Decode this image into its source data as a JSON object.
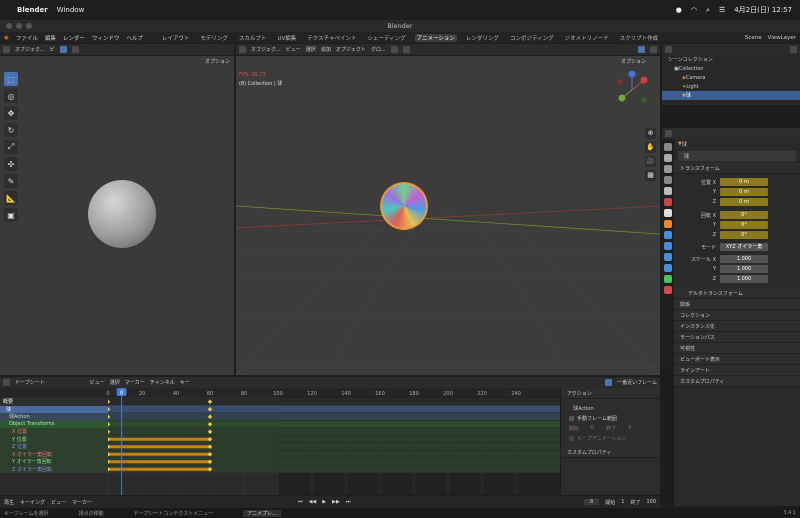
{
  "mac": {
    "app_name": "Blender",
    "menu_window": "Window",
    "datetime": "4月2日(日) 12:57"
  },
  "window": {
    "title": "Blender",
    "version": "3.4.1"
  },
  "topmenu": {
    "items": [
      "ファイル",
      "編集",
      "レンダー",
      "ウィンドウ",
      "ヘルプ"
    ],
    "tabs": [
      "レイアウト",
      "モデリング",
      "スカルプト",
      "UV編集",
      "テクスチャペイント",
      "シェーディング",
      "アニメーション",
      "レンダリング",
      "コンポジティング",
      "ジオメトリノード",
      "スクリプト作成"
    ],
    "active_tab": "アニメーション",
    "scene": "Scene",
    "view_layer": "ViewLayer"
  },
  "left_vp": {
    "mode": "オブジェク...",
    "view_label": "ビ",
    "options": "オプション"
  },
  "main_vp": {
    "mode": "オブジェク...",
    "menus": [
      "ビュー",
      "選択",
      "追加",
      "オブジェクト"
    ],
    "transform": "グロ...",
    "options": "オプション",
    "fps": "FPS: 29.73",
    "collection_label": "(8) Collection | 球"
  },
  "outliner": {
    "root": "シーンコレクション",
    "collection": "Collection",
    "items": [
      "Camera",
      "Light",
      "球"
    ]
  },
  "properties": {
    "object_name": "球",
    "mesh_name": "球",
    "transform_title": "トランスフォーム",
    "location": {
      "label": "位置 X",
      "y": "Y",
      "z": "Z",
      "x_val": "0 m",
      "y_val": "0 m",
      "z_val": "0 m"
    },
    "rotation": {
      "label": "回転 X",
      "y": "Y",
      "z": "Z",
      "x_val": "0°",
      "y_val": "0°",
      "z_val": "0°"
    },
    "mode_label": "モード",
    "mode_val": "XYZ オイラー角",
    "scale": {
      "label": "スケール X",
      "y": "Y",
      "z": "Z",
      "x_val": "1.000",
      "y_val": "1.000",
      "z_val": "1.000"
    },
    "sections": [
      "デルタトランスフォーム",
      "関係",
      "コレクション",
      "インスタンス化",
      "モーションパス",
      "可視性",
      "ビューポート表示",
      "ラインアート",
      "カスタムプロパティ"
    ]
  },
  "dopesheet": {
    "mode": "ドープシート",
    "menus": [
      "ビュー",
      "選択",
      "マーカー",
      "チャンネル",
      "キー"
    ],
    "interp": "一番近いフレーム",
    "frame_ticks": [
      "0",
      "20",
      "40",
      "60",
      "80",
      "100",
      "120",
      "140",
      "160",
      "180",
      "200",
      "220",
      "240"
    ],
    "current_frame": "8",
    "channels": [
      "概要",
      "球",
      "球Action",
      "Object Transforms",
      "X 位置",
      "Y 位置",
      "Z 位置",
      "X オイラー角回転",
      "Y オイラー角回転",
      "Z オイラー角回転"
    ]
  },
  "action_panel": {
    "title": "アクション",
    "action_name": "球Action",
    "manual_range": "手動フレーム範囲",
    "start": "開始",
    "end": "終了",
    "start_val": "0",
    "end_val": "0",
    "cyclic": "ループアニメーション",
    "custom_props": "カスタムプロパティ"
  },
  "timeline": {
    "playback": "再生",
    "keying": "キーイング",
    "view": "ビュー",
    "marker": "マーカー",
    "current": "8",
    "start_label": "開始",
    "start": "1",
    "end_label": "終了",
    "end": "100"
  },
  "status": {
    "hint1": "キーフレームを選択",
    "hint2": "視点の移動",
    "hint3": "ドープシートコンテクストメニュー",
    "active": "アニメプレ..."
  }
}
